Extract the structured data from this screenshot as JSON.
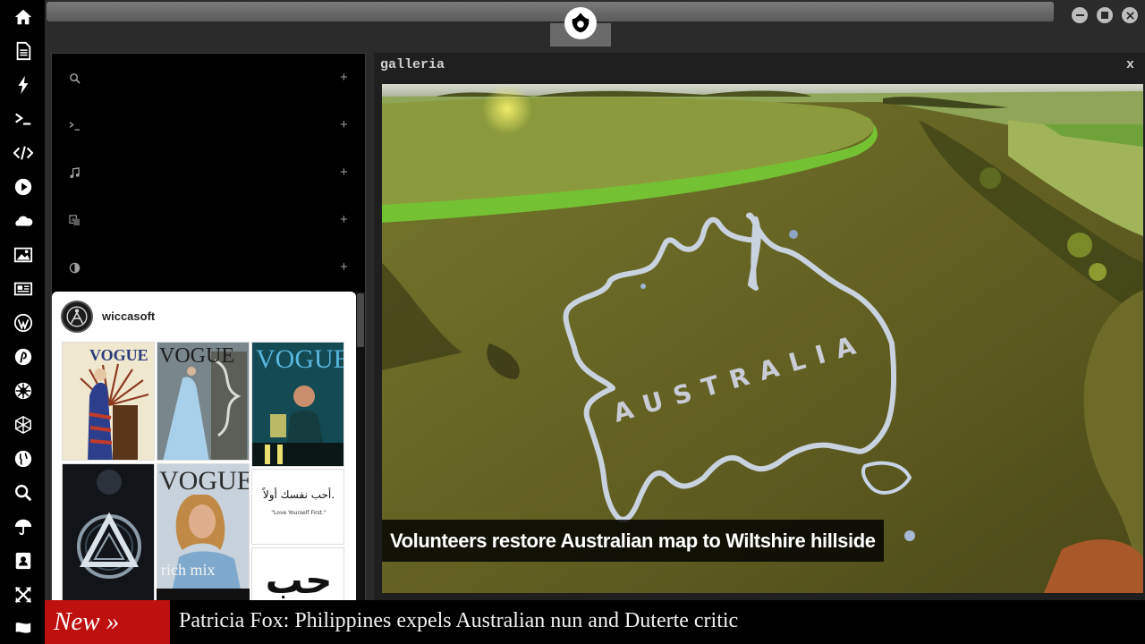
{
  "window": {
    "controls": [
      "minimize-icon",
      "maximize-icon",
      "close-icon"
    ],
    "logo": "rebel-alliance-icon"
  },
  "rail": {
    "items": [
      "home-icon",
      "document-icon",
      "bolt-icon",
      "terminal-icon",
      "code-icon",
      "play-icon",
      "cloud-icon",
      "image-icon",
      "newspaper-icon",
      "wordpress-icon",
      "pinterest-icon",
      "empire-icon",
      "network-icon",
      "globe-icon",
      "search-icon",
      "umbrella-icon",
      "contact-card-icon",
      "expand-icon",
      "flag-icon"
    ]
  },
  "panel": {
    "rows": [
      {
        "icon": "search-icon",
        "plus": "+"
      },
      {
        "icon": "terminal-icon",
        "plus": "+"
      },
      {
        "icon": "music-icon",
        "plus": "+"
      },
      {
        "icon": "translate-icon",
        "plus": "+"
      },
      {
        "icon": "contrast-icon",
        "plus": "+"
      }
    ]
  },
  "feed": {
    "username": "wiccasoft",
    "tiles": [
      {
        "id": "vogue-cover-1",
        "text": "VOGUE"
      },
      {
        "id": "vogue-cover-2",
        "text": "VOGUE"
      },
      {
        "id": "vogue-cover-3",
        "text": "VOGUE"
      },
      {
        "id": "geometric-art",
        "text": ""
      },
      {
        "id": "vogue-cover-4",
        "text": "VOGUE",
        "sub": "rich mix"
      },
      {
        "id": "arabic-quote",
        "text": "أحب نفسك أولاً.",
        "sub": "\"Love Yourself First.\""
      },
      {
        "id": "arabic-love",
        "text": "حب"
      }
    ]
  },
  "galleria": {
    "title": "galleria",
    "close_label": "x",
    "image_text": "AUSTRALIA",
    "caption": "Volunteers restore Australian map to Wiltshire hillside"
  },
  "ticker": {
    "label": "New »",
    "headline": "Patricia Fox: Philippines expels Australian nun and Duterte critic"
  }
}
